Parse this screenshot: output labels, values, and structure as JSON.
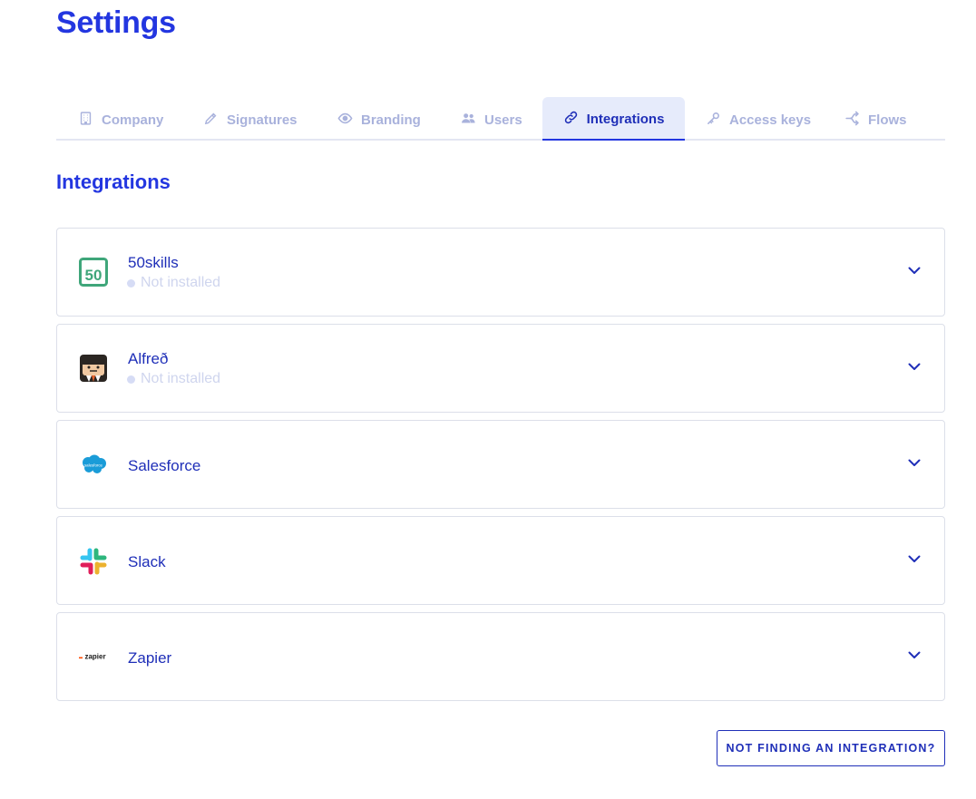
{
  "page": {
    "title": "Settings"
  },
  "tabs": [
    {
      "label": "Company",
      "icon": "building-icon",
      "active": false
    },
    {
      "label": "Signatures",
      "icon": "pencil-icon",
      "active": false
    },
    {
      "label": "Branding",
      "icon": "eye-icon",
      "active": false
    },
    {
      "label": "Users",
      "icon": "users-icon",
      "active": false
    },
    {
      "label": "Integrations",
      "icon": "link-icon",
      "active": true
    },
    {
      "label": "Access keys",
      "icon": "key-icon",
      "active": false
    },
    {
      "label": "Flows",
      "icon": "flows-icon",
      "active": false
    }
  ],
  "section": {
    "title": "Integrations"
  },
  "integrations": [
    {
      "name": "50skills",
      "status": "Not installed",
      "logo": "50skills-logo"
    },
    {
      "name": "Alfreð",
      "status": "Not installed",
      "logo": "alfred-logo"
    },
    {
      "name": "Salesforce",
      "status": "",
      "logo": "salesforce-logo",
      "logo_text": "salesforce"
    },
    {
      "name": "Slack",
      "status": "",
      "logo": "slack-logo"
    },
    {
      "name": "Zapier",
      "status": "",
      "logo": "zapier-logo",
      "logo_text": "zapier"
    }
  ],
  "cta": {
    "label": "NOT FINDING AN INTEGRATION?"
  },
  "colors": {
    "primary": "#2336e0",
    "primary_dark": "#1f2fb8",
    "tab_inactive": "#a9b2dc",
    "tab_active_bg": "#e6ebfb",
    "status_muted": "#cfd5ee"
  }
}
